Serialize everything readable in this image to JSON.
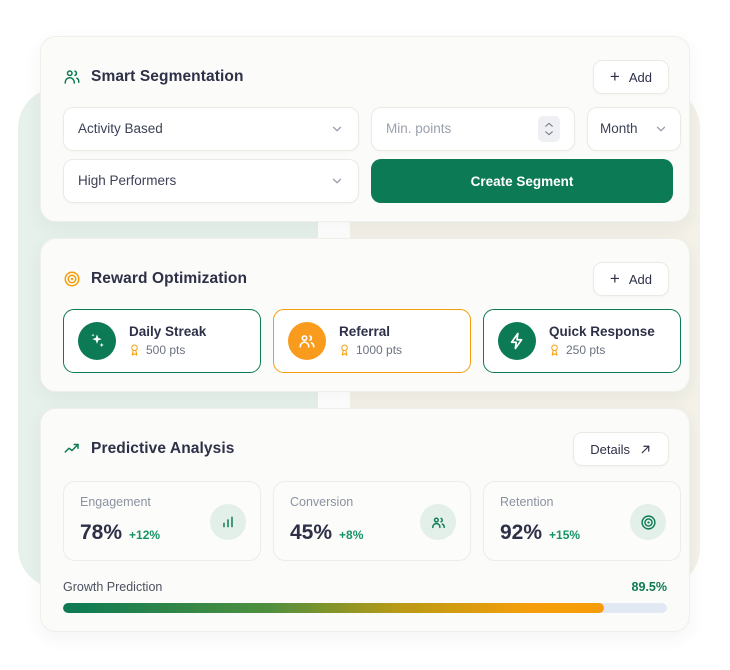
{
  "theme": {
    "brand_green": "#0c7a55",
    "accent_orange": "#f59e0b",
    "title_color": "#2d3047",
    "page_background": "#ffffff",
    "blob_mint": "#e7f1ec",
    "blob_cream": "#f3f1e8"
  },
  "segmentation": {
    "title": "Smart Segmentation",
    "title_icon": "users-icon",
    "add_button": {
      "label": "Add",
      "icon": "plus-icon"
    },
    "type_select": {
      "value": "Activity Based",
      "icon": "chevron-down-icon"
    },
    "points_input": {
      "placeholder": "Min. points",
      "value": "",
      "icon": "stepper-icon"
    },
    "period_select": {
      "value": "Month",
      "icon": "chevron-down-icon"
    },
    "tier_select": {
      "value": "High Performers",
      "icon": "chevron-down-icon"
    },
    "create_button": {
      "label": "Create Segment"
    }
  },
  "rewards": {
    "title": "Reward Optimization",
    "title_icon": "target-icon",
    "add_button": {
      "label": "Add",
      "icon": "plus-icon"
    },
    "items": [
      {
        "name": "Daily Streak",
        "points": "500 pts",
        "icon": "sparkles-icon",
        "badge_color": "#0c7a55",
        "border_color": "#0c7a55",
        "points_icon": "medal-icon"
      },
      {
        "name": "Referral",
        "points": "1000 pts",
        "icon": "users-icon",
        "badge_color": "#f99b1c",
        "border_color": "#f59e0b",
        "points_icon": "medal-icon"
      },
      {
        "name": "Quick Response",
        "points": "250 pts",
        "icon": "lightning-icon",
        "badge_color": "#0c7a55",
        "border_color": "#0c7a55",
        "points_icon": "medal-icon"
      }
    ]
  },
  "predictive": {
    "title": "Predictive Analysis",
    "title_icon": "trend-up-icon",
    "details_button": {
      "label": "Details",
      "icon": "arrow-up-right-icon"
    },
    "metrics": [
      {
        "label": "Engagement",
        "value": "78%",
        "delta": "+12%",
        "icon": "bar-chart-icon"
      },
      {
        "label": "Conversion",
        "value": "45%",
        "delta": "+8%",
        "icon": "users-icon"
      },
      {
        "label": "Retention",
        "value": "92%",
        "delta": "+15%",
        "icon": "target-icon"
      }
    ],
    "progress": {
      "label": "Growth Prediction",
      "value_text": "89.5%",
      "percent": 89.5
    }
  }
}
